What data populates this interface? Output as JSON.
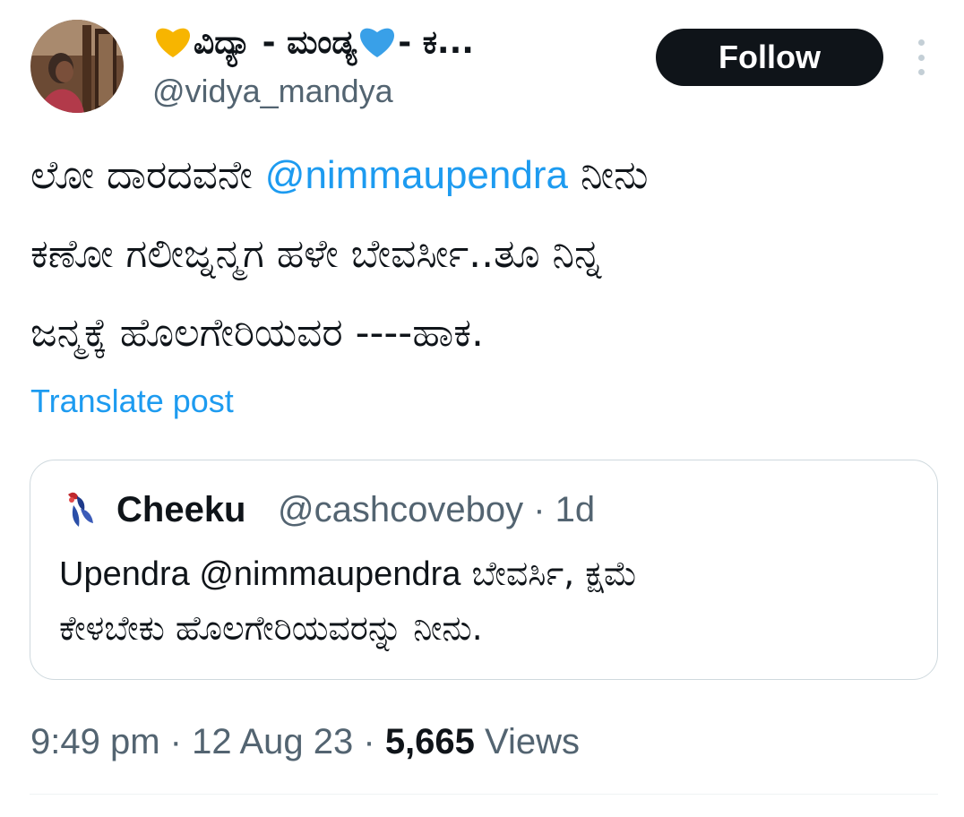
{
  "author": {
    "display_name_text": "ವಿದ್ಯಾ - ಮಂಡ್ಯ",
    "display_name_suffix": "- ಕ...",
    "handle": "@vidya_mandya",
    "follow_label": "Follow",
    "heart_colors": [
      "#f7b500",
      "#39a0e8"
    ]
  },
  "tweet": {
    "line1_before": "ಲೋ ದಾರದವನೇ ",
    "mention": "@nimmaupendra",
    "line1_after": " ನೀನು",
    "line2": "ಕಣೋ ಗಲೀಜ್ನನ್ಮಗ ಹಳೇ ಬೇವರ್ಸೀ..ತೂ ನಿನ್ನ",
    "line3": "ಜನ್ಮಕ್ಕೆ ಹೊಲಗೇರಿಯವರ ----ಹಾಕ.",
    "translate_label": "Translate post"
  },
  "quote": {
    "name": "Cheeku",
    "handle_time": "@cashcoveboy · 1d",
    "text_en": "Upendra @nimmaupendra",
    "text_kn1": " ಬೇವರ್ಸಿ, ಕ್ಷಮೆ",
    "text_kn2": "ಕೇಳಬೇಕು ಹೊಲಗೇರಿಯವರನ್ನು ನೀನು."
  },
  "meta": {
    "time_date": "9:49 pm · 12 Aug 23 · ",
    "views_count": "5,665",
    "views_label": " Views"
  }
}
